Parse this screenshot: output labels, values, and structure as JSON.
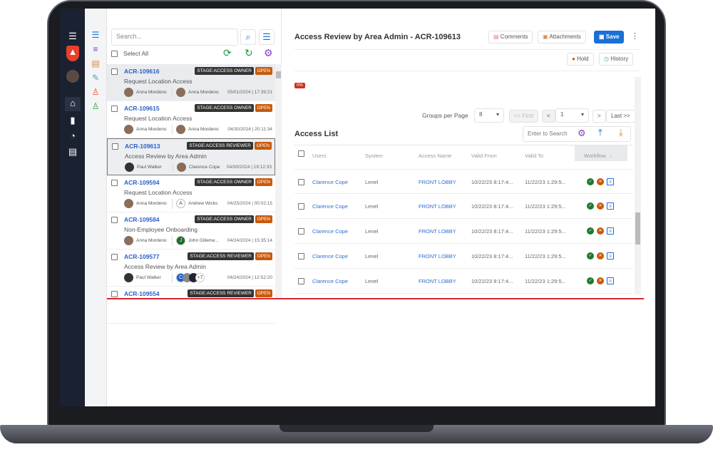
{
  "sidebar": {
    "icons": [
      "menu-icon",
      "shield-logo",
      "avatar",
      "home-icon",
      "document-icon",
      "pie-chart-icon",
      "archive-icon"
    ]
  },
  "strip": {
    "icons": [
      "list-icon",
      "wrap-list-icon",
      "notes-icon",
      "checklist-icon",
      "user-remove-icon",
      "user-add-icon"
    ],
    "colors": [
      "#1a6fd8",
      "#7b3fc4",
      "#d08a4a",
      "#4aa0a8",
      "#e0552b",
      "#2a9a3a"
    ]
  },
  "list": {
    "search_placeholder": "Search...",
    "select_all": "Select All",
    "items": [
      {
        "id": "ACR-109616",
        "stage": "STAGE:ACCESS OWNER",
        "status": "OPEN",
        "title": "Request Location Access",
        "from": "Anna Mordeno",
        "to": "Anna Mordeno",
        "timestamp": "05/01/2024 | 17:39:21"
      },
      {
        "id": "ACR-109615",
        "stage": "STAGE:ACCESS OWNER",
        "status": "OPEN",
        "title": "Request Location Access",
        "from": "Anna Mordeno",
        "to": "Anna Mordeno",
        "timestamp": "04/30/2024 | 20:11:34"
      },
      {
        "id": "ACR-109613",
        "stage": "STAGE:ACCESS REVIEWER",
        "status": "OPEN",
        "title": "Access Review by Area Admin",
        "from": "Paul Walker",
        "to": "Clarence Cope",
        "timestamp": "04/30/2024 | 19:12:33"
      },
      {
        "id": "ACR-109594",
        "stage": "STAGE:ACCESS OWNER",
        "status": "OPEN",
        "title": "Request Location Access",
        "from": "Anna Mordeno",
        "to": "Andrew Wicks",
        "to_initial": "A",
        "timestamp": "04/25/2024 | 00:02:15"
      },
      {
        "id": "ACR-109584",
        "stage": "STAGE:ACCESS OWNER",
        "status": "OPEN",
        "title": "Non-Employee Onboarding",
        "from": "Anna Mordeno",
        "to": "John Gillenw...",
        "to_initial": "J",
        "timestamp": "04/24/2024 | 15:35:14"
      },
      {
        "id": "ACR-109577",
        "stage": "STAGE:ACCESS REVIEWER",
        "status": "OPEN",
        "title": "Access Review by Area Admin",
        "from": "Paul Walker",
        "to": "",
        "to_initial": "C",
        "more": "+7",
        "timestamp": "04/24/2024 | 12:52:20"
      },
      {
        "id": "ACR-109554",
        "stage": "STAGE:ACCESS REVIEWER",
        "status": "OPEN",
        "title": "",
        "from": "",
        "to": "",
        "timestamp": ""
      }
    ]
  },
  "main": {
    "title": "Access Review by Area Admin - ACR-109613",
    "comments": "Comments",
    "attachments": "Attachments",
    "save": "Save",
    "hold": "Hold",
    "history": "History",
    "progress": "0%",
    "progress_value": 0,
    "groups_label": "Groups per Page",
    "groups_value": "8",
    "first": "<< First",
    "prev": "<",
    "page": "1",
    "next": ">",
    "last": "Last >>",
    "access_list": "Access List",
    "search_placeholder": "Enter to Search",
    "columns": [
      "Users",
      "System",
      "Access Name",
      "Valid From",
      "Valid To",
      "Workflow"
    ],
    "rows": [
      {
        "user": "Clarence Cope",
        "system": "Lenel",
        "access": "FRONT LOBBY",
        "from": "10/22/23 8:17:4...",
        "to": "11/22/23 1:29:5..."
      },
      {
        "user": "Clarence Cope",
        "system": "Lenel",
        "access": "FRONT LOBBY",
        "from": "10/22/23 8:17:4...",
        "to": "11/22/23 1:29:5..."
      },
      {
        "user": "Clarence Cope",
        "system": "Lenel",
        "access": "FRONT LOBBY",
        "from": "10/22/23 8:17:4...",
        "to": "11/22/23 1:29:5..."
      },
      {
        "user": "Clarence Cope",
        "system": "Lenel",
        "access": "FRONT LOBBY",
        "from": "10/22/23 8:17:4...",
        "to": "11/22/23 1:29:5..."
      },
      {
        "user": "Clarence Cope",
        "system": "Lenel",
        "access": "FRONT LOBBY",
        "from": "10/22/23 8:17:4...",
        "to": "11/22/23 1:29:5..."
      }
    ]
  },
  "colors": {
    "accent": "#1a6fd8",
    "open": "#c85a0c",
    "approve": "#1e7a2e",
    "reject": "#c85a0c",
    "progress": "#d0301a"
  }
}
